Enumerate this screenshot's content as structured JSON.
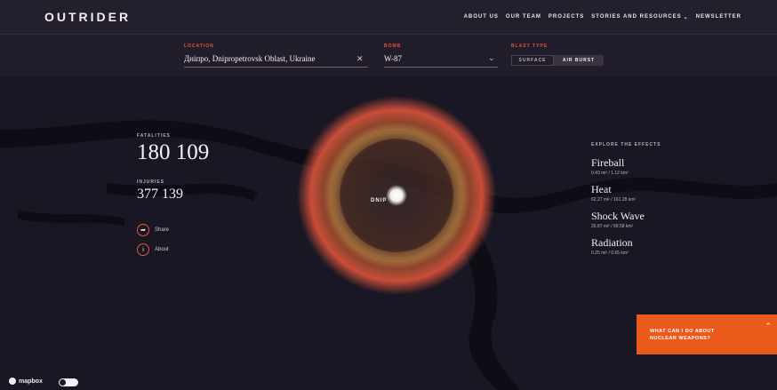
{
  "nav": {
    "logo": "OUTRIDER",
    "links": [
      "ABOUT US",
      "OUR TEAM",
      "PROJECTS",
      "STORIES AND RESOURCES",
      "NEWSLETTER"
    ]
  },
  "controls": {
    "location_label": "LOCATION",
    "location_value": "Дніпро, Dnipropetrovsk Oblast, Ukraine",
    "bomb_label": "BOMB",
    "bomb_value": "W-87",
    "blast_label": "BLAST TYPE",
    "blast_options": [
      "SURFACE",
      "AIR BURST"
    ],
    "blast_selected": "AIR BURST"
  },
  "stats": {
    "fatalities_label": "FATALITIES",
    "fatalities_value": "180 109",
    "injuries_label": "INJURIES",
    "injuries_value": "377 139"
  },
  "actions": {
    "share_label": "Share",
    "about_label": "About"
  },
  "map": {
    "city_label": "DNIP"
  },
  "effects": {
    "title": "EXPLORE THE EFFECTS",
    "items": [
      {
        "name": "Fireball",
        "value": "0.43 mi² / 1.12 km²"
      },
      {
        "name": "Heat",
        "value": "62.27 mi² / 161.28 km²"
      },
      {
        "name": "Shock Wave",
        "value": "26.87 mi² / 69.58 km²"
      },
      {
        "name": "Radiation",
        "value": "0.25 mi² / 0.65 km²"
      }
    ]
  },
  "cta": {
    "text": "WHAT CAN I DO ABOUT NUCLEAR WEAPONS?"
  },
  "footer": {
    "mapbox": "mapbox"
  },
  "colors": {
    "accent": "#e7553a",
    "cta": "#ea5a1a",
    "background": "#1b1826"
  }
}
